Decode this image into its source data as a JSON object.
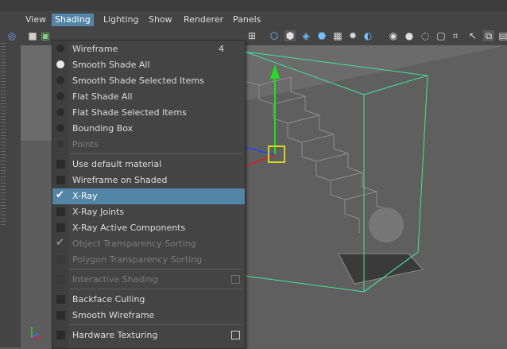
{
  "menubar": {
    "items": [
      {
        "label": "View",
        "active": false
      },
      {
        "label": "Shading",
        "active": true
      },
      {
        "label": "Lighting",
        "active": false
      },
      {
        "label": "Show",
        "active": false
      },
      {
        "label": "Renderer",
        "active": false
      },
      {
        "label": "Panels",
        "active": false
      }
    ]
  },
  "toolbar": {
    "icons": [
      "camera-icon",
      "image-plane-icon",
      "display-resolution-icon",
      "wireframe-icon",
      "smooth-shade-icon",
      "xray-icon",
      "textured-icon",
      "lighting-icon",
      "shadows-icon",
      "ambient-occlusion-icon",
      "antialiasing-icon",
      "depth-of-field-icon",
      "isolate-select-icon",
      "xray-joints-icon",
      "select-icon",
      "component-icon"
    ]
  },
  "shading_menu": {
    "items": [
      {
        "label": "Wireframe",
        "shortcut": "4",
        "type": "radio",
        "state": "off"
      },
      {
        "label": "Smooth Shade All",
        "shortcut": "",
        "type": "radio",
        "state": "on"
      },
      {
        "label": "Smooth Shade Selected Items",
        "shortcut": "",
        "type": "radio",
        "state": "off"
      },
      {
        "label": "Flat Shade All",
        "shortcut": "",
        "type": "radio",
        "state": "off"
      },
      {
        "label": "Flat Shade Selected Items",
        "shortcut": "",
        "type": "radio",
        "state": "off"
      },
      {
        "label": "Bounding Box",
        "shortcut": "",
        "type": "radio",
        "state": "off"
      },
      {
        "label": "Points",
        "shortcut": "",
        "type": "radio",
        "state": "disabled"
      },
      {
        "label": "Use default material",
        "shortcut": "",
        "type": "checkbox",
        "state": "off"
      },
      {
        "label": "Wireframe on Shaded",
        "shortcut": "",
        "type": "checkbox",
        "state": "off"
      },
      {
        "label": "X-Ray",
        "shortcut": "",
        "type": "checkbox",
        "state": "checked",
        "highlighted": true
      },
      {
        "label": "X-Ray Joints",
        "shortcut": "",
        "type": "checkbox",
        "state": "off"
      },
      {
        "label": "X-Ray Active Components",
        "shortcut": "",
        "type": "checkbox",
        "state": "off"
      },
      {
        "label": "Object Transparency Sorting",
        "shortcut": "",
        "type": "checkbox",
        "state": "checked-disabled"
      },
      {
        "label": "Polygon Transparency Sorting",
        "shortcut": "",
        "type": "checkbox",
        "state": "disabled"
      },
      {
        "label": "Interactive Shading",
        "shortcut": "",
        "type": "checkbox",
        "state": "disabled",
        "option_box": true
      },
      {
        "label": "Backface Culling",
        "shortcut": "",
        "type": "checkbox",
        "state": "off"
      },
      {
        "label": "Smooth Wireframe",
        "shortcut": "",
        "type": "checkbox",
        "state": "off"
      },
      {
        "label": "Hardware Texturing",
        "shortcut": "",
        "type": "checkbox",
        "state": "off",
        "option_box": true
      }
    ]
  },
  "colors": {
    "highlight": "#5285a6",
    "wireframe_selected": "#44e39a",
    "manipulator_y": "#22dd22",
    "manipulator_center": "#ffff00",
    "manipulator_x": "#dd2222",
    "manipulator_z": "#2244ff"
  }
}
